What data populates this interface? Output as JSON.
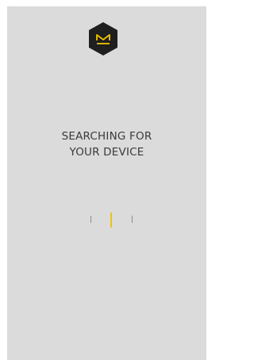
{
  "app": {
    "logo_icon": "hexagon-m-logo-icon",
    "accent_color": "#f2c400",
    "background_color": "#dbdbdb"
  },
  "status": {
    "line1": "SEARCHING FOR",
    "line2": "YOUR DEVICE"
  },
  "progress": {
    "ticks": 3,
    "active_index": 1
  }
}
